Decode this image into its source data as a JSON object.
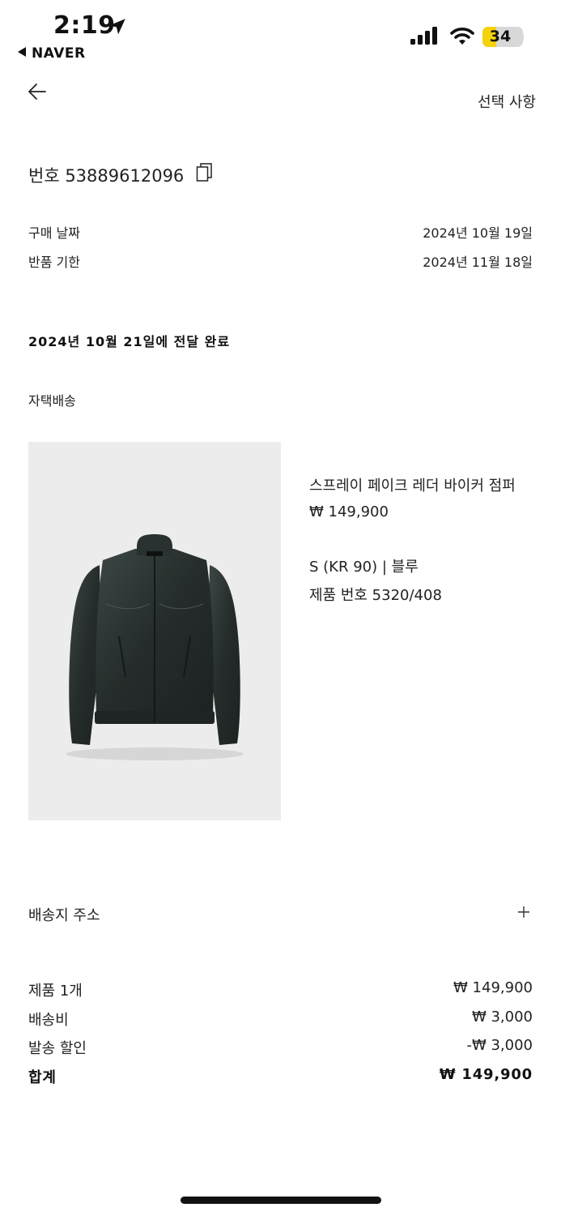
{
  "status_bar": {
    "time": "2:19",
    "back_app": "NAVER",
    "battery": "34",
    "battery_color": "#f5d20b"
  },
  "header": {
    "options": "선택 사항"
  },
  "order": {
    "number": "번호 53889612096",
    "purchase_date_label": "구매 날짜",
    "purchase_date": "2024년 10월 19일",
    "return_deadline_label": "반품 기한",
    "return_deadline": "2024년 11월 18일",
    "delivery_status": "2024년 10월 21일에 전달 완료",
    "shipping_method": "자택배송"
  },
  "product": {
    "name": "스프레이 페이크 레더 바이커 점퍼",
    "price": "₩ 149,900",
    "variant": "S (KR 90) | 블루",
    "ref": "제품 번호 5320/408"
  },
  "address": {
    "label": "배송지 주소"
  },
  "summary": {
    "items_label": "제품 1개",
    "items_value": "₩ 149,900",
    "shipping_label": "배송비",
    "shipping_value": "₩ 3,000",
    "discount_label": "발송 할인",
    "discount_value": "-₩ 3,000",
    "total_label": "합계",
    "total_value": "₩ 149,900"
  }
}
